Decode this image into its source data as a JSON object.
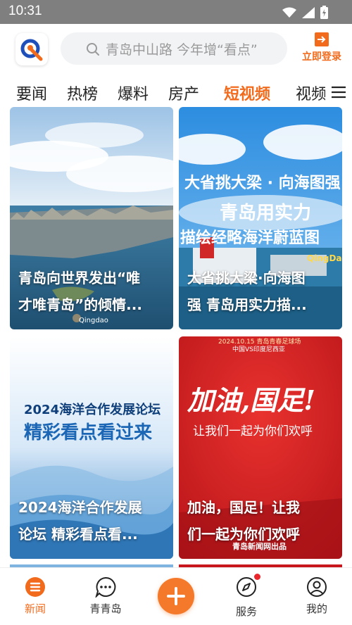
{
  "status_bar": {
    "time": "10:31",
    "icons": [
      "wifi-icon",
      "signal-icon",
      "battery-icon"
    ]
  },
  "header": {
    "logo": "qingdao-news-logo",
    "search_placeholder": "青岛中山路 今年增“看点”",
    "login_label": "立即登录"
  },
  "tabs": [
    {
      "label": "要闻",
      "active": false
    },
    {
      "label": "热榜",
      "active": false
    },
    {
      "label": "爆料",
      "active": false
    },
    {
      "label": "房产",
      "active": false
    },
    {
      "label": "短视频",
      "active": true
    },
    {
      "label": "视频",
      "active": false
    }
  ],
  "accent_color": "#f26b1d",
  "cards": [
    {
      "title_line1": "青岛向世界发出“唯",
      "title_line2": "才唯青岛”的倾情...",
      "watermark": "Qingdao"
    },
    {
      "title_line1": "大省挑大梁·向海图",
      "title_line2": "强 青岛用实力描...",
      "banner_top": "大省挑大梁 · 向海图强",
      "banner_mid": "青岛用实力",
      "banner_bottom": "描绘经略海洋蔚蓝图",
      "corner_tag": "QingDa"
    },
    {
      "title_line1": "2024海洋合作发展",
      "title_line2": "论坛 精彩看点看...",
      "poster_line1": "2024海洋合作发展论坛",
      "poster_line2": "精彩看点看过来"
    },
    {
      "title_line1": "加油，国足！让我",
      "title_line2": "们一起为你们欢呼",
      "top_line1": "2024.10.15 青岛青春足球场",
      "top_line2": "中国VS印度尼西亚",
      "calligraphy": "加油,国足!",
      "subtitle": "让我们一起为你们欢呼",
      "brand_tag": "青岛新闻网出品"
    }
  ],
  "bottom_nav": [
    {
      "label": "新闻",
      "icon": "news-icon",
      "active": true
    },
    {
      "label": "青青岛",
      "icon": "chat-icon",
      "active": false
    },
    {
      "label": "",
      "icon": "plus-icon",
      "active": false
    },
    {
      "label": "服务",
      "icon": "compass-icon",
      "active": false,
      "badge": true
    },
    {
      "label": "我的",
      "icon": "user-icon",
      "active": false
    }
  ]
}
